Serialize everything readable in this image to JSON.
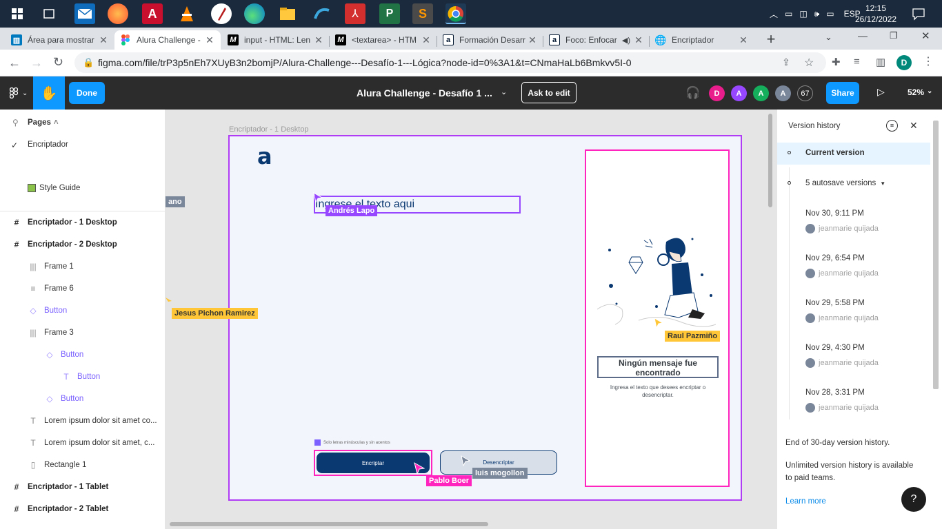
{
  "taskbar": {
    "language": "ESP",
    "time": "12:15",
    "date": "26/12/2022"
  },
  "tabs": [
    {
      "title": "Área para mostrar",
      "favicon": "trello-icon"
    },
    {
      "title": "Alura Challenge - ",
      "favicon": "figma-icon"
    },
    {
      "title": "input - HTML: Len",
      "favicon": "mdn-icon"
    },
    {
      "title": "<textarea> - HTM",
      "favicon": "mdn-icon"
    },
    {
      "title": "Formación Desarr",
      "favicon": "alura-icon"
    },
    {
      "title": "Foco: Enfocar",
      "favicon": "alura-icon"
    },
    {
      "title": "Encriptador",
      "favicon": "globe-icon"
    }
  ],
  "address": {
    "url": "figma.com/file/trP3p5nEh7XUyB3n2bomjP/Alura-Challenge---Desafío-1---Lógica?node-id=0%3A1&t=CNmaHaLb6Bmkvv5I-0",
    "profile_initial": "D"
  },
  "figma_toolbar": {
    "done_label": "Done",
    "file_title": "Alura Challenge - Desafío 1 ...",
    "ask_to_edit": "Ask to edit",
    "avatars": [
      {
        "initial": "D",
        "color": "#e91e8c"
      },
      {
        "initial": "A",
        "color": "#9747ff"
      },
      {
        "initial": "A",
        "color": "#14ae5c"
      },
      {
        "initial": "A",
        "color": "#7a869a"
      }
    ],
    "viewer_count": "67",
    "share_label": "Share",
    "zoom": "52%"
  },
  "left_panel": {
    "pages_label": "Pages",
    "pages": [
      "Encriptador",
      "Style Guide"
    ],
    "layers": [
      {
        "label": "Encriptador - 1 Desktop",
        "icon": "#",
        "indent": 0,
        "style": "bold"
      },
      {
        "label": "Encriptador - 2 Desktop",
        "icon": "#",
        "indent": 0,
        "style": "bold"
      },
      {
        "label": "Frame 1",
        "icon": "|||",
        "indent": 1,
        "style": "normal"
      },
      {
        "label": "Frame 6",
        "icon": "≡",
        "indent": 1,
        "style": "normal"
      },
      {
        "label": "Button",
        "icon": "◇",
        "indent": 1,
        "style": "purple"
      },
      {
        "label": "Frame 3",
        "icon": "|||",
        "indent": 1,
        "style": "normal"
      },
      {
        "label": "Button",
        "icon": "◇",
        "indent": 2,
        "style": "purple"
      },
      {
        "label": "Button",
        "icon": "T",
        "indent": 3,
        "style": "purple"
      },
      {
        "label": "Button",
        "icon": "◇",
        "indent": 2,
        "style": "purple"
      },
      {
        "label": "Lorem ipsum dolor sit amet co...",
        "icon": "T",
        "indent": 1,
        "style": "normal"
      },
      {
        "label": "Lorem ipsum dolor sit amet, c...",
        "icon": "T",
        "indent": 1,
        "style": "normal"
      },
      {
        "label": "Rectangle 1",
        "icon": "▯",
        "indent": 1,
        "style": "normal"
      },
      {
        "label": "Encriptador - 1 Tablet",
        "icon": "#",
        "indent": 0,
        "style": "bold"
      },
      {
        "label": "Encriptador - 2 Tablet",
        "icon": "#",
        "indent": 0,
        "style": "bold"
      }
    ]
  },
  "canvas": {
    "frame_label": "Encriptador - 1 Desktop",
    "logo": "a",
    "input_placeholder": "Ingrese el texto aqui",
    "hint": "Solo letras minúsculas y sin acentos",
    "encrypt_label": "Encriptar",
    "decrypt_label": "Desencriptar",
    "no_message_title": "Ningún mensaje fue encontrado",
    "no_message_body": "Ingresa el texto que desees encriptar o desencriptar.",
    "cursors": [
      {
        "name": "ano",
        "color": "#7a869a"
      },
      {
        "name": "Andrés Lapo",
        "color": "#9747ff"
      },
      {
        "name": "Jesus Pichon Ramirez",
        "color": "#ffc737"
      },
      {
        "name": "Raul Pazmiño",
        "color": "#ffc737"
      },
      {
        "name": "Pablo Boer",
        "color": "#ff24bd"
      },
      {
        "name": "luis mogollon",
        "color": "#7a869a"
      }
    ]
  },
  "version_history": {
    "title": "Version history",
    "current": "Current version",
    "autosave": "5 autosave versions",
    "versions": [
      {
        "date": "Nov 30, 9:11 PM",
        "user": "jeanmarie quijada"
      },
      {
        "date": "Nov 29, 6:54 PM",
        "user": "jeanmarie quijada"
      },
      {
        "date": "Nov 29, 5:58 PM",
        "user": "jeanmarie quijada"
      },
      {
        "date": "Nov 29, 4:30 PM",
        "user": "jeanmarie quijada"
      },
      {
        "date": "Nov 28, 3:31 PM",
        "user": "jeanmarie quijada"
      }
    ],
    "end_note": "End of 30-day version history.",
    "upsell": "Unlimited version history is available to paid teams.",
    "learn_more": "Learn more"
  }
}
